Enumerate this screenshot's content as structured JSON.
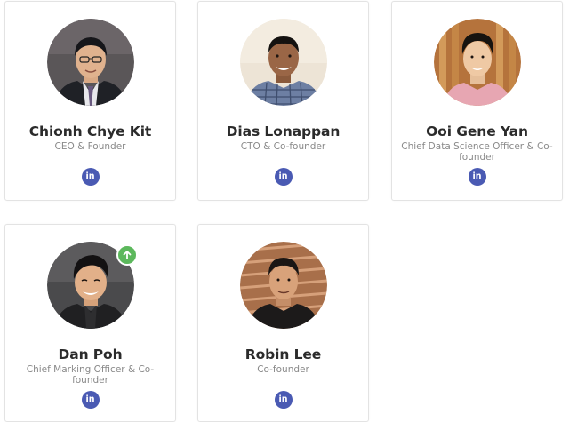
{
  "team": [
    {
      "name": "Chionh Chye Kit",
      "role": "CEO & Founder",
      "linkedin_label": "in"
    },
    {
      "name": "Dias Lonappan",
      "role": "CTO & Co-founder",
      "linkedin_label": "in"
    },
    {
      "name": "Ooi Gene Yan",
      "role": "Chief Data Science Officer & Co-founder",
      "linkedin_label": "in"
    },
    {
      "name": "Dan Poh",
      "role": "Chief Marking Officer & Co-founder",
      "linkedin_label": "in"
    },
    {
      "name": "Robin Lee",
      "role": "Co-founder",
      "linkedin_label": "in"
    }
  ],
  "icons": {
    "linkedin": "linkedin-icon",
    "scroll_top": "arrow-up-icon"
  },
  "colors": {
    "linkedin_button": "#4a5ab3",
    "badge": "#5cb85c",
    "name_text": "#2b2b2b",
    "role_text": "#8a8a8a"
  }
}
